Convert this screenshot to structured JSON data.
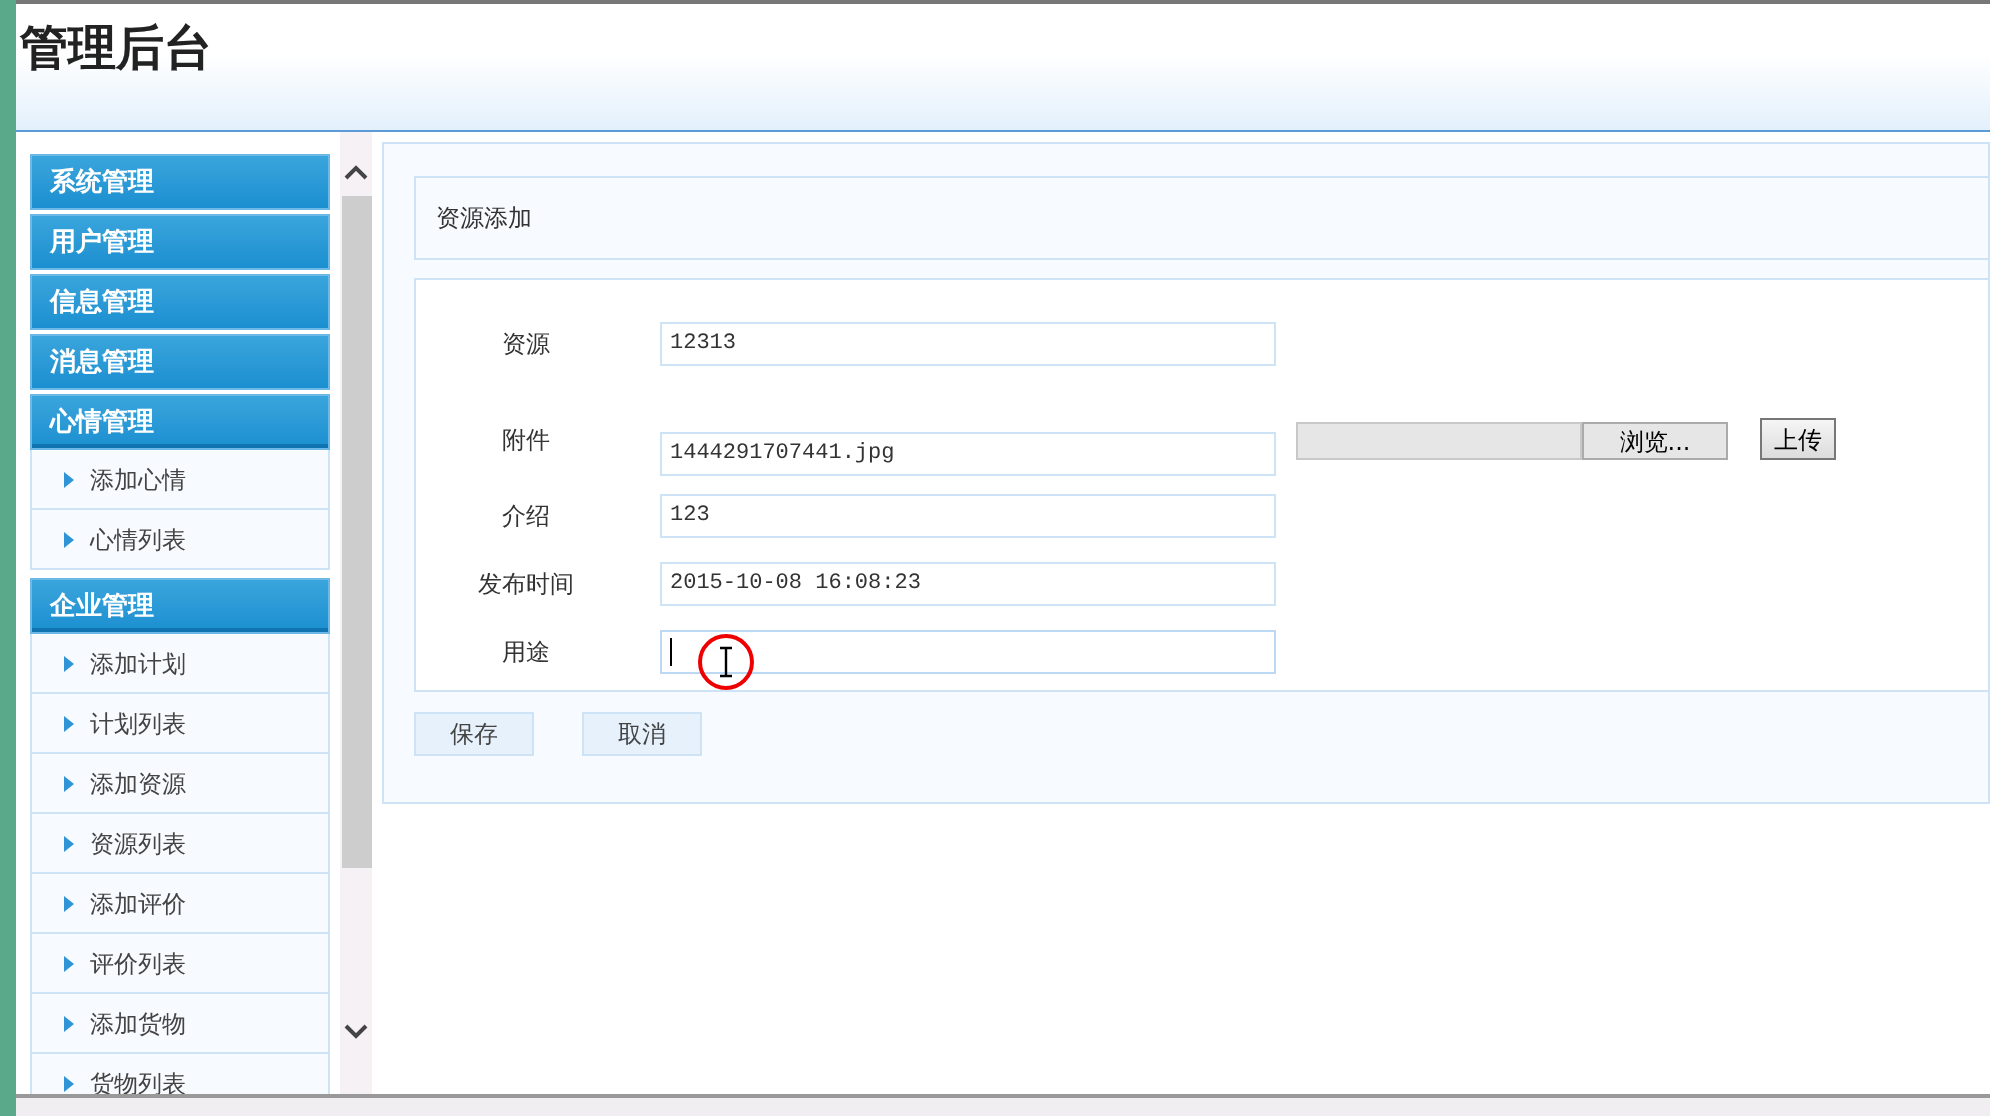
{
  "header": {
    "title": "管理后台"
  },
  "sidebar": {
    "groups": [
      {
        "label": "系统管理",
        "expanded": false
      },
      {
        "label": "用户管理",
        "expanded": false
      },
      {
        "label": "信息管理",
        "expanded": false
      },
      {
        "label": "消息管理",
        "expanded": false
      },
      {
        "label": "心情管理",
        "expanded": true,
        "children": [
          {
            "label": "添加心情"
          },
          {
            "label": "心情列表"
          }
        ]
      },
      {
        "label": "企业管理",
        "expanded": true,
        "children": [
          {
            "label": "添加计划"
          },
          {
            "label": "计划列表"
          },
          {
            "label": "添加资源"
          },
          {
            "label": "资源列表"
          },
          {
            "label": "添加评价"
          },
          {
            "label": "评价列表"
          },
          {
            "label": "添加货物"
          },
          {
            "label": "货物列表"
          }
        ]
      }
    ]
  },
  "form": {
    "title": "资源添加",
    "fields": [
      {
        "kind": "text",
        "label": "资源",
        "value": "12313",
        "focused": false
      },
      {
        "kind": "file",
        "label": "附件",
        "value": "1444291707441.jpg",
        "focused": false,
        "browse_button": "浏览...",
        "upload_button": "上传"
      },
      {
        "kind": "text",
        "label": "介绍",
        "value": "123",
        "focused": false
      },
      {
        "kind": "text",
        "label": "发布时间",
        "value": "2015-10-08 16:08:23",
        "focused": false
      },
      {
        "kind": "text",
        "label": "用途",
        "focused": true
      }
    ],
    "buttons": [
      "保存",
      "取消"
    ]
  }
}
